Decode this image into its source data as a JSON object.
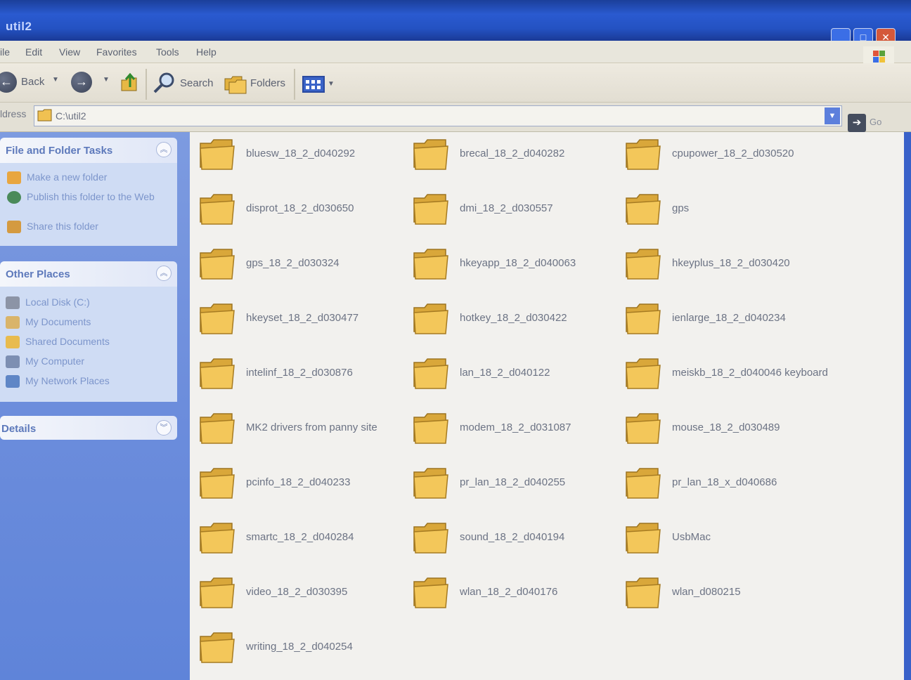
{
  "window": {
    "title": "util2"
  },
  "menu": [
    "ile",
    "Edit",
    "View",
    "Favorites",
    "Tools",
    "Help"
  ],
  "toolbar": {
    "back_label": "Back",
    "search_label": "Search",
    "folders_label": "Folders"
  },
  "address": {
    "label": "ldress",
    "value": "C:\\util2",
    "go_label": "Go"
  },
  "tasks_panel": {
    "title": "File and Folder Tasks",
    "items": [
      {
        "label": "Make a new folder",
        "icon": "new-folder-icon"
      },
      {
        "label": "Publish this folder to the Web",
        "icon": "publish-web-icon"
      },
      {
        "label": "Share this folder",
        "icon": "share-folder-icon"
      }
    ]
  },
  "places_panel": {
    "title": "Other Places",
    "items": [
      {
        "label": "Local Disk (C:)",
        "icon": "local-disk-icon"
      },
      {
        "label": "My Documents",
        "icon": "my-documents-icon"
      },
      {
        "label": "Shared Documents",
        "icon": "shared-documents-icon"
      },
      {
        "label": "My Computer",
        "icon": "my-computer-icon"
      },
      {
        "label": "My Network Places",
        "icon": "network-places-icon"
      }
    ]
  },
  "details_panel": {
    "title": "Details"
  },
  "folders": [
    "bluesw_18_2_d040292",
    "brecal_18_2_d040282",
    "cpupower_18_2_d030520",
    "disprot_18_2_d030650",
    "dmi_18_2_d030557",
    "gps",
    "gps_18_2_d030324",
    "hkeyapp_18_2_d040063",
    "hkeyplus_18_2_d030420",
    "hkeyset_18_2_d030477",
    "hotkey_18_2_d030422",
    "ienlarge_18_2_d040234",
    "intelinf_18_2_d030876",
    "lan_18_2_d040122",
    "meiskb_18_2_d040046 keyboard",
    "MK2 drivers from panny site",
    "modem_18_2_d031087",
    "mouse_18_2_d030489",
    "pcinfo_18_2_d040233",
    "pr_lan_18_2_d040255",
    "pr_lan_18_x_d040686",
    "smartc_18_2_d040284",
    "sound_18_2_d040194",
    "UsbMac",
    "video_18_2_d030395",
    "wlan_18_2_d040176",
    "wlan_d080215",
    "writing_18_2_d040254"
  ],
  "colors": {
    "titlebar": "#2452c2",
    "taskpane": "#6c8ddc",
    "folder_yellow": "#f3c75a"
  }
}
